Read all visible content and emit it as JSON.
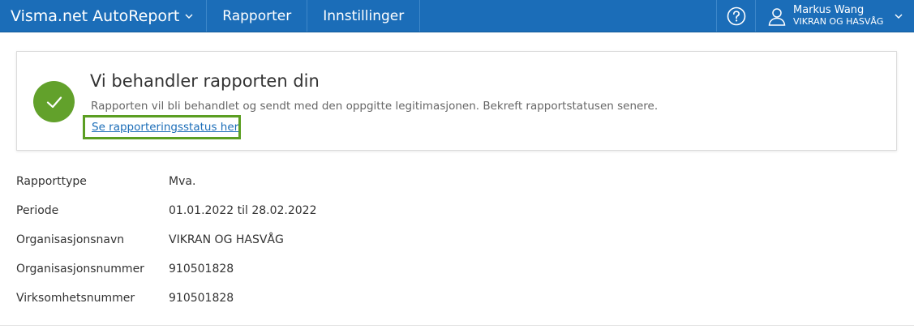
{
  "topbar": {
    "brand": "Visma.net AutoReport",
    "nav": [
      "Rapporter",
      "Innstillinger"
    ],
    "user_name": "Markus Wang",
    "user_org": "VIKRAN OG HASVÅG",
    "help_icon": "question-circle-icon",
    "avatar_icon": "user-outline-icon"
  },
  "message": {
    "title": "Vi behandler rapporten din",
    "description": "Rapporten vil bli behandlet og sendt med den oppgitte legitimasjonen. Bekreft rapportstatusen senere.",
    "link": "Se rapporteringsstatus her",
    "status_icon": "check-icon",
    "accent": "#62a12b",
    "highlight": "#5b9e22"
  },
  "details": [
    {
      "label": "Rapporttype",
      "value": "Mva."
    },
    {
      "label": "Periode",
      "value": "01.01.2022 til 28.02.2022"
    },
    {
      "label": "Organisasjonsnavn",
      "value": "VIKRAN OG HASVÅG"
    },
    {
      "label": "Organisasjonsnummer",
      "value": "910501828"
    },
    {
      "label": "Virksomhetsnummer",
      "value": "910501828"
    }
  ],
  "colors": {
    "topbar": "#1b6db8",
    "link": "#1b6db8"
  }
}
